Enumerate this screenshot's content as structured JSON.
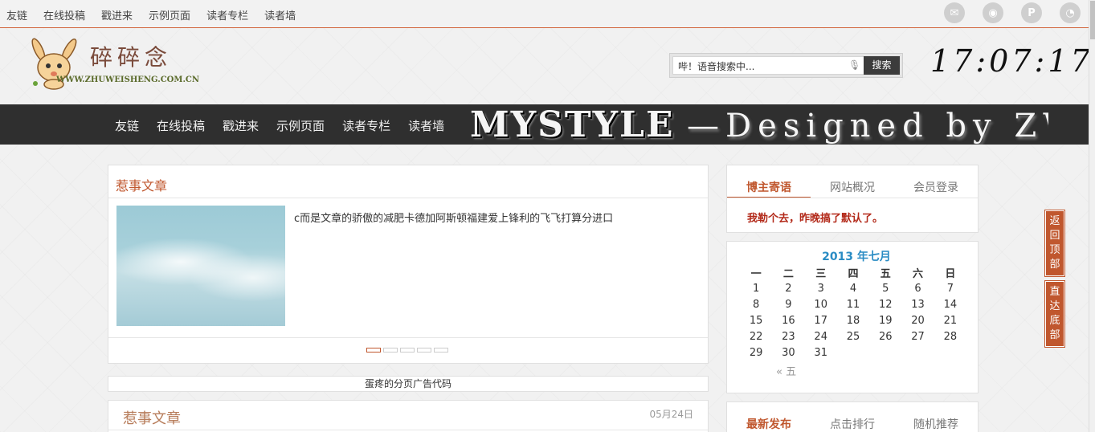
{
  "topbar": {
    "links": [
      "友链",
      "在线投稿",
      "戳进来",
      "示例页面",
      "读者专栏",
      "读者墙"
    ],
    "social_icons": [
      "mail-icon",
      "weibo-icon",
      "pinterest-icon",
      "rss-icon"
    ]
  },
  "logo": {
    "title": "碎碎念",
    "domain": "WWW.ZHUWEISHENG.COM.CN"
  },
  "search": {
    "placeholder": "哔！语音搜索中...",
    "button": "搜索"
  },
  "clock": "17:07:17",
  "nav": {
    "links": [
      "友链",
      "在线投稿",
      "戳进来",
      "示例页面",
      "读者专栏",
      "读者墙"
    ],
    "banner_main": "MYSTYLE",
    "banner_sub": "—Designed by ZWS"
  },
  "featured": {
    "title": "惹事文章",
    "excerpt": "c而是文章的骄傲的减肥卡德加阿斯顿福建爱上锋利的飞飞打算分进口"
  },
  "ad_text": "蛋疼的分页广告代码",
  "post": {
    "title": "惹事文章",
    "date": "05月24日"
  },
  "sidebar": {
    "tabs": [
      "博主寄语",
      "网站概况",
      "会员登录"
    ],
    "message": "我勒个去，昨晚搞了默认了。",
    "bottom_tabs": [
      "最新发布",
      "点击排行",
      "随机推荐"
    ]
  },
  "calendar": {
    "caption": "2013 年七月",
    "weekdays": [
      "一",
      "二",
      "三",
      "四",
      "五",
      "六",
      "日"
    ],
    "weeks": [
      [
        "1",
        "2",
        "3",
        "4",
        "5",
        "6",
        "7"
      ],
      [
        "8",
        "9",
        "10",
        "11",
        "12",
        "13",
        "14"
      ],
      [
        "15",
        "16",
        "17",
        "18",
        "19",
        "20",
        "21"
      ],
      [
        "22",
        "23",
        "24",
        "25",
        "26",
        "27",
        "28"
      ],
      [
        "29",
        "30",
        "31",
        "",
        "",
        "",
        ""
      ]
    ],
    "prev": "« 五"
  },
  "float_buttons": {
    "top": "返回顶部",
    "bottom": "直达底部"
  },
  "colors": {
    "accent": "#c0572e",
    "nav_bg": "#2f2f2f",
    "calendar_caption": "#2a8cc4"
  }
}
